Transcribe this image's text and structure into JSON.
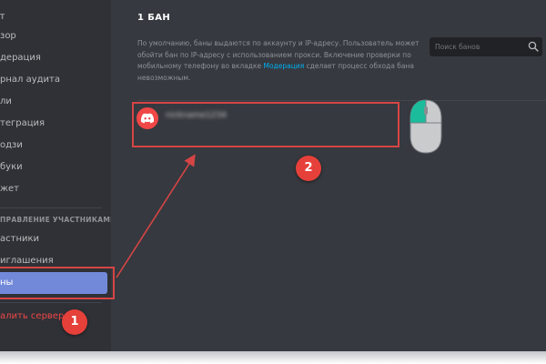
{
  "sidebar": {
    "section_header_partial": "Т",
    "items": [
      {
        "label": "зор"
      },
      {
        "label": "дерация"
      },
      {
        "label": "рнал аудита"
      },
      {
        "label": "ли"
      },
      {
        "label": "теграция"
      },
      {
        "label": "одзи"
      },
      {
        "label": "буки"
      },
      {
        "label": "жет"
      }
    ],
    "members_section_header": "ПРАВЛЕНИЕ УЧАСТНИКАМИ",
    "member_items": [
      {
        "label": "астники"
      },
      {
        "label": "иглашения"
      },
      {
        "label": "ны"
      }
    ],
    "delete_server_label": "алить сервер"
  },
  "main": {
    "title": "1 БАН",
    "description_before_link": "По умолчанию, баны выдаются по аккаунту и IP-адресу. Пользователь может обойти бан по IP-адресу с использованием прокси. Включение проверки по мобильному телефону во вкладке ",
    "description_link": "Модерация",
    "description_after_link": " сделает процесс обхода бана невозможным.",
    "search": {
      "placeholder": "Поиск банов",
      "value": ""
    },
    "banned_users": [
      {
        "username": "nickname1234",
        "avatar_icon": "discord-logo-icon"
      }
    ]
  },
  "annotations": {
    "step_1": "1",
    "step_2": "2",
    "highlight_color": "#d64545",
    "badge_color": "#e6403a"
  },
  "colors": {
    "sidebar_bg": "#2f3136",
    "main_bg": "#36393f",
    "active_item_bg": "#7289da",
    "link": "#00b0f4",
    "danger": "#f04747"
  }
}
